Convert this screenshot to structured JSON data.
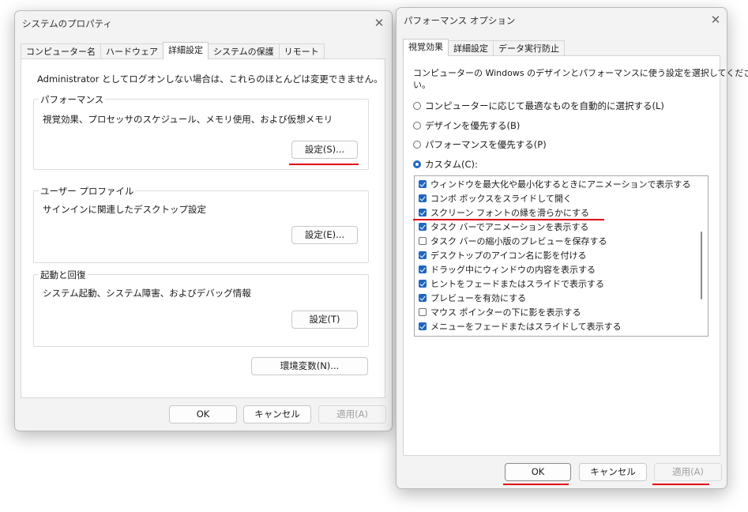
{
  "sys": {
    "title": "システムのプロパティ",
    "tabs": [
      "コンピューター名",
      "ハードウェア",
      "詳細設定",
      "システムの保護",
      "リモート"
    ],
    "admin_note": "Administrator としてログオンしない場合は、これらのほとんどは変更できません。",
    "perf_group": "パフォーマンス",
    "perf_desc": "視覚効果、プロセッサのスケジュール、メモリ使用、および仮想メモリ",
    "perf_btn": "設定(S)...",
    "profile_group": "ユーザー プロファイル",
    "profile_desc": "サインインに関連したデスクトップ設定",
    "profile_btn": "設定(E)...",
    "startup_group": "起動と回復",
    "startup_desc": "システム起動、システム障害、およびデバッグ情報",
    "startup_btn": "設定(T)",
    "env_btn": "環境変数(N)...",
    "ok": "OK",
    "cancel": "キャンセル",
    "apply": "適用(A)"
  },
  "perf": {
    "title": "パフォーマンス オプション",
    "tabs": [
      "視覚効果",
      "詳細設定",
      "データ実行防止"
    ],
    "instruction_line1": "コンピューターの Windows のデザインとパフォーマンスに使う設定を選択してくださ",
    "instruction_line2": "い。",
    "radios": [
      {
        "label": "コンピューターに応じて最適なものを自動的に選択する(L)",
        "checked": false
      },
      {
        "label": "デザインを優先する(B)",
        "checked": false
      },
      {
        "label": "パフォーマンスを優先する(P)",
        "checked": false
      },
      {
        "label": "カスタム(C):",
        "checked": true
      }
    ],
    "options": [
      {
        "label": "ウィンドウを最大化や最小化するときにアニメーションで表示する",
        "checked": true
      },
      {
        "label": "コンボ ボックスをスライドして開く",
        "checked": true
      },
      {
        "label": "スクリーン フォントの縁を滑らかにする",
        "checked": true
      },
      {
        "label": "タスク バーでアニメーションを表示する",
        "checked": true
      },
      {
        "label": "タスク バーの縮小版のプレビューを保存する",
        "checked": false
      },
      {
        "label": "デスクトップのアイコン名に影を付ける",
        "checked": true
      },
      {
        "label": "ドラッグ中にウィンドウの内容を表示する",
        "checked": true
      },
      {
        "label": "ヒントをフェードまたはスライドで表示する",
        "checked": true
      },
      {
        "label": "プレビューを有効にする",
        "checked": true
      },
      {
        "label": "マウス ポインターの下に影を表示する",
        "checked": false
      },
      {
        "label": "メニューをフェードまたはスライドして表示する",
        "checked": true
      }
    ],
    "ok": "OK",
    "cancel": "キャンセル",
    "apply": "適用(A)"
  },
  "colors": {
    "accent": "#1f66c1",
    "highlight": "#e0000f"
  }
}
